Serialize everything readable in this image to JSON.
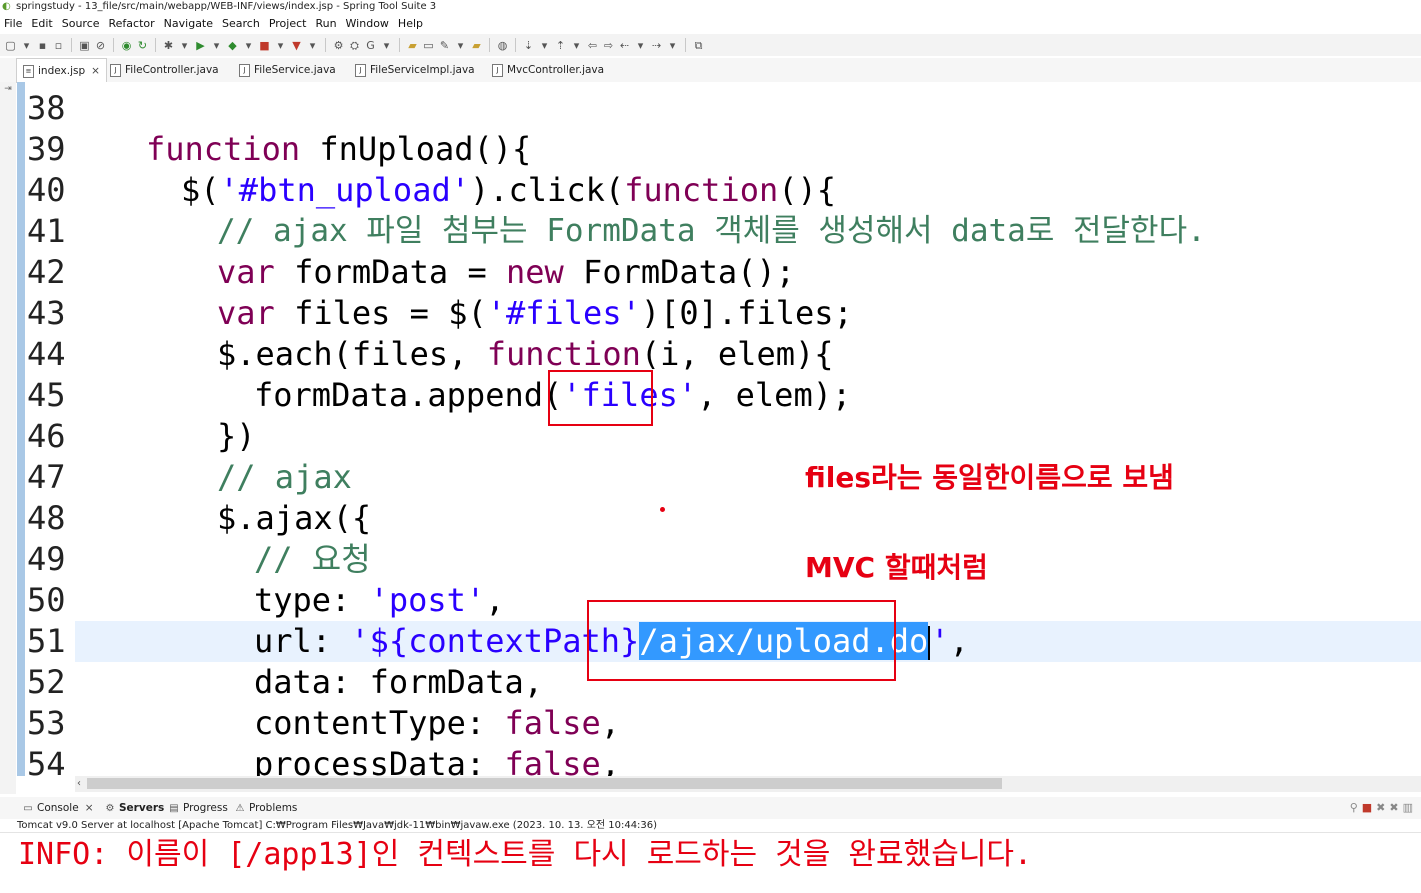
{
  "window": {
    "title": "springstudy - 13_file/src/main/webapp/WEB-INF/views/index.jsp - Spring Tool Suite 3"
  },
  "menu": [
    "File",
    "Edit",
    "Source",
    "Refactor",
    "Navigate",
    "Search",
    "Project",
    "Run",
    "Window",
    "Help"
  ],
  "editor_tabs": [
    {
      "label": "index.jsp",
      "active": true
    },
    {
      "label": "FileController.java"
    },
    {
      "label": "FileService.java"
    },
    {
      "label": "FileServiceImpl.java"
    },
    {
      "label": "MvcController.java"
    }
  ],
  "code": {
    "line_numbers": [
      "38",
      "39",
      "40",
      "41",
      "42",
      "43",
      "44",
      "45",
      "46",
      "47",
      "48",
      "49",
      "50",
      "51",
      "52",
      "53",
      "54"
    ],
    "current_line": "51",
    "l39_kw": "function",
    "l39_rest": " fnUpload(){",
    "l40_a": "$(",
    "l40_str": "'#btn_upload'",
    "l40_b": ").click(",
    "l40_kw": "function",
    "l40_c": "(){",
    "l41_cmt": "// ajax 파일 첨부는 FormData 객체를 생성해서 data로 전달한다.",
    "l42_kw1": "var",
    "l42_mid": " formData = ",
    "l42_kw2": "new",
    "l42_rest": " FormData();",
    "l43_kw": "var",
    "l43_a": " files = $(",
    "l43_str": "'#files'",
    "l43_b": ")[0].files;",
    "l44_a": "$.each(files, ",
    "l44_kw": "function",
    "l44_b": "(i, elem){",
    "l45_a": "formData.append(",
    "l45_q1": "'",
    "l45_files": "files",
    "l45_q2": "'",
    "l45_b": ", elem);",
    "l46": "})",
    "l47_cmt": "// ajax",
    "l48": "$.ajax({",
    "l49_cmt": "// 요청",
    "l50_a": "type: ",
    "l50_str": "'post'",
    "l50_b": ",",
    "l51_a": "url: ",
    "l51_str1": "'${contextPath}",
    "l51_sel": "/ajax/upload.do",
    "l51_str2": "'",
    "l51_b": ",",
    "l52": "data: formData,",
    "l53_a": "contentType: ",
    "l53_kw": "false",
    "l53_b": ",",
    "l54_a": "processData: ",
    "l54_kw": "false",
    "l54_b": ","
  },
  "annotations": {
    "note1": "files라는 동일한이름으로 보냄",
    "note2": "MVC 할때처럼"
  },
  "console": {
    "tabs": [
      {
        "label": "Console",
        "icon": "console-icon"
      },
      {
        "label": "Servers",
        "icon": "servers-icon"
      },
      {
        "label": "Progress",
        "icon": "progress-icon"
      },
      {
        "label": "Problems",
        "icon": "problems-icon"
      }
    ],
    "header": "Tomcat v9.0 Server at localhost [Apache Tomcat] C:₩Program Files₩Java₩jdk-11₩bin₩javaw.exe  (2023. 10. 13. 오전 10:44:36)",
    "output": "INFO: 이름이 [/app13]인 컨텍스트를 다시 로드하는 것을 완료했습니다."
  },
  "colors": {
    "keyword": "#7f0055",
    "string": "#2a00ff",
    "comment": "#3f7f5f",
    "annotation": "#e60012",
    "selection": "#3399ff",
    "current_line": "#e8f2fe"
  }
}
